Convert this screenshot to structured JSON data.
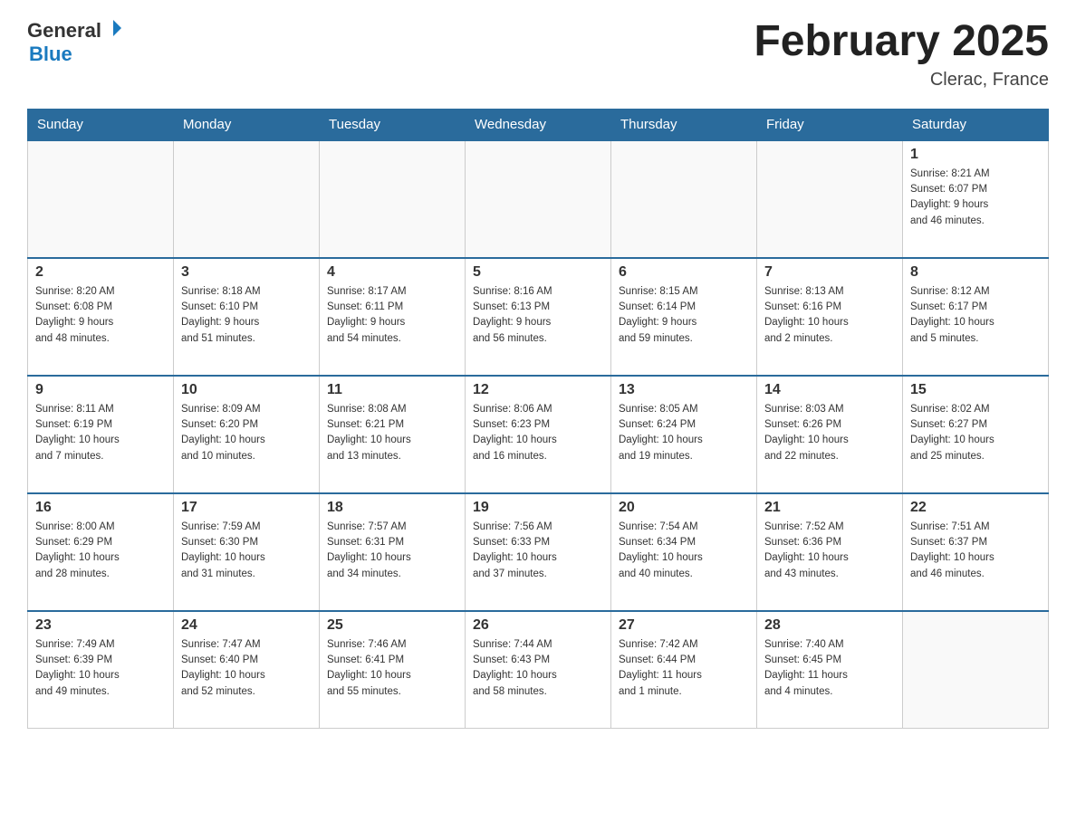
{
  "header": {
    "logo_general": "General",
    "logo_blue": "Blue",
    "title": "February 2025",
    "subtitle": "Clerac, France"
  },
  "days_of_week": [
    "Sunday",
    "Monday",
    "Tuesday",
    "Wednesday",
    "Thursday",
    "Friday",
    "Saturday"
  ],
  "weeks": [
    {
      "days": [
        {
          "date": "",
          "info": ""
        },
        {
          "date": "",
          "info": ""
        },
        {
          "date": "",
          "info": ""
        },
        {
          "date": "",
          "info": ""
        },
        {
          "date": "",
          "info": ""
        },
        {
          "date": "",
          "info": ""
        },
        {
          "date": "1",
          "info": "Sunrise: 8:21 AM\nSunset: 6:07 PM\nDaylight: 9 hours\nand 46 minutes."
        }
      ]
    },
    {
      "days": [
        {
          "date": "2",
          "info": "Sunrise: 8:20 AM\nSunset: 6:08 PM\nDaylight: 9 hours\nand 48 minutes."
        },
        {
          "date": "3",
          "info": "Sunrise: 8:18 AM\nSunset: 6:10 PM\nDaylight: 9 hours\nand 51 minutes."
        },
        {
          "date": "4",
          "info": "Sunrise: 8:17 AM\nSunset: 6:11 PM\nDaylight: 9 hours\nand 54 minutes."
        },
        {
          "date": "5",
          "info": "Sunrise: 8:16 AM\nSunset: 6:13 PM\nDaylight: 9 hours\nand 56 minutes."
        },
        {
          "date": "6",
          "info": "Sunrise: 8:15 AM\nSunset: 6:14 PM\nDaylight: 9 hours\nand 59 minutes."
        },
        {
          "date": "7",
          "info": "Sunrise: 8:13 AM\nSunset: 6:16 PM\nDaylight: 10 hours\nand 2 minutes."
        },
        {
          "date": "8",
          "info": "Sunrise: 8:12 AM\nSunset: 6:17 PM\nDaylight: 10 hours\nand 5 minutes."
        }
      ]
    },
    {
      "days": [
        {
          "date": "9",
          "info": "Sunrise: 8:11 AM\nSunset: 6:19 PM\nDaylight: 10 hours\nand 7 minutes."
        },
        {
          "date": "10",
          "info": "Sunrise: 8:09 AM\nSunset: 6:20 PM\nDaylight: 10 hours\nand 10 minutes."
        },
        {
          "date": "11",
          "info": "Sunrise: 8:08 AM\nSunset: 6:21 PM\nDaylight: 10 hours\nand 13 minutes."
        },
        {
          "date": "12",
          "info": "Sunrise: 8:06 AM\nSunset: 6:23 PM\nDaylight: 10 hours\nand 16 minutes."
        },
        {
          "date": "13",
          "info": "Sunrise: 8:05 AM\nSunset: 6:24 PM\nDaylight: 10 hours\nand 19 minutes."
        },
        {
          "date": "14",
          "info": "Sunrise: 8:03 AM\nSunset: 6:26 PM\nDaylight: 10 hours\nand 22 minutes."
        },
        {
          "date": "15",
          "info": "Sunrise: 8:02 AM\nSunset: 6:27 PM\nDaylight: 10 hours\nand 25 minutes."
        }
      ]
    },
    {
      "days": [
        {
          "date": "16",
          "info": "Sunrise: 8:00 AM\nSunset: 6:29 PM\nDaylight: 10 hours\nand 28 minutes."
        },
        {
          "date": "17",
          "info": "Sunrise: 7:59 AM\nSunset: 6:30 PM\nDaylight: 10 hours\nand 31 minutes."
        },
        {
          "date": "18",
          "info": "Sunrise: 7:57 AM\nSunset: 6:31 PM\nDaylight: 10 hours\nand 34 minutes."
        },
        {
          "date": "19",
          "info": "Sunrise: 7:56 AM\nSunset: 6:33 PM\nDaylight: 10 hours\nand 37 minutes."
        },
        {
          "date": "20",
          "info": "Sunrise: 7:54 AM\nSunset: 6:34 PM\nDaylight: 10 hours\nand 40 minutes."
        },
        {
          "date": "21",
          "info": "Sunrise: 7:52 AM\nSunset: 6:36 PM\nDaylight: 10 hours\nand 43 minutes."
        },
        {
          "date": "22",
          "info": "Sunrise: 7:51 AM\nSunset: 6:37 PM\nDaylight: 10 hours\nand 46 minutes."
        }
      ]
    },
    {
      "days": [
        {
          "date": "23",
          "info": "Sunrise: 7:49 AM\nSunset: 6:39 PM\nDaylight: 10 hours\nand 49 minutes."
        },
        {
          "date": "24",
          "info": "Sunrise: 7:47 AM\nSunset: 6:40 PM\nDaylight: 10 hours\nand 52 minutes."
        },
        {
          "date": "25",
          "info": "Sunrise: 7:46 AM\nSunset: 6:41 PM\nDaylight: 10 hours\nand 55 minutes."
        },
        {
          "date": "26",
          "info": "Sunrise: 7:44 AM\nSunset: 6:43 PM\nDaylight: 10 hours\nand 58 minutes."
        },
        {
          "date": "27",
          "info": "Sunrise: 7:42 AM\nSunset: 6:44 PM\nDaylight: 11 hours\nand 1 minute."
        },
        {
          "date": "28",
          "info": "Sunrise: 7:40 AM\nSunset: 6:45 PM\nDaylight: 11 hours\nand 4 minutes."
        },
        {
          "date": "",
          "info": ""
        }
      ]
    }
  ]
}
